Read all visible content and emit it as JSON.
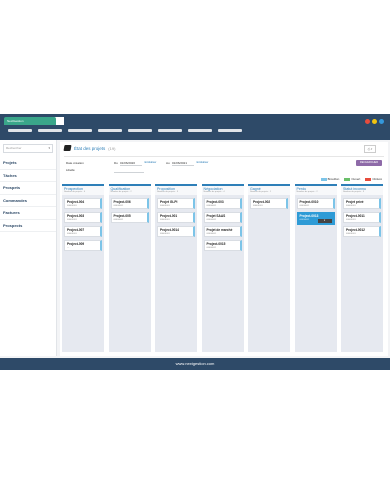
{
  "app": {
    "brand": "NextGestion"
  },
  "window_dots": [
    "#e74c3c",
    "#f1c40f",
    "#3498db"
  ],
  "sidebar": {
    "search_placeholder": "Rechercher",
    "items": [
      {
        "label": "Projets"
      },
      {
        "label": "Tâches"
      },
      {
        "label": "Prospets"
      },
      {
        "label": "Commandes"
      },
      {
        "label": "Factures"
      },
      {
        "label": "Prospects"
      }
    ]
  },
  "header": {
    "title": "État des projets",
    "count": "(19)",
    "print_label": "⎙ ▾"
  },
  "filters": {
    "creation_label": "Date création",
    "from_label": "Du",
    "from_value": "01/06/2020",
    "from_link": "réinitialiser",
    "to_label": "Au",
    "to_value": "01/06/2021",
    "to_link": "réinitialiser",
    "libelle_label": "Libellé",
    "search_button": "RECHERCHER"
  },
  "legend": [
    {
      "label": "Brouillon",
      "color": "#7cc4e8"
    },
    {
      "label": "Ouvert",
      "color": "#6abf69"
    },
    {
      "label": "Clôturé",
      "color": "#e74c3c"
    }
  ],
  "columns": [
    {
      "title": "Prospection",
      "sub": "Nombre de projets : 4",
      "cards": [
        {
          "title": "Project-004",
          "meta": "00000001"
        },
        {
          "title": "Project-003",
          "meta": "00000001"
        },
        {
          "title": "Project-007",
          "meta": "00000001"
        },
        {
          "title": "Project-009",
          "meta": "—"
        }
      ]
    },
    {
      "title": "Qualification",
      "sub": "Nombre de projets : 2",
      "cards": [
        {
          "title": "Project-006",
          "meta": "00000001"
        },
        {
          "title": "Project-005",
          "meta": "00000001"
        }
      ]
    },
    {
      "title": "Proposition",
      "sub": "Nombre de projets : 3",
      "cards": [
        {
          "title": "Projet GLPI",
          "meta": "00000001"
        },
        {
          "title": "Project-001",
          "meta": "00000001"
        },
        {
          "title": "Project-0014",
          "meta": "00000001"
        }
      ]
    },
    {
      "title": "Négociation",
      "sub": "Nombre de projets : 4",
      "cards": [
        {
          "title": "Project-003",
          "meta": "00000001"
        },
        {
          "title": "Projet SAAS",
          "meta": "00000001"
        },
        {
          "title": "Projet de marché",
          "meta": "00000001"
        },
        {
          "title": "Project-0015",
          "meta": "00000001"
        }
      ]
    },
    {
      "title": "Gagné",
      "sub": "Nombre de projets : 1",
      "cards": [
        {
          "title": "Project-002",
          "meta": "00000001"
        }
      ]
    },
    {
      "title": "Perdu",
      "sub": "Nombre de projets : 2",
      "cards": [
        {
          "title": "Project-0010",
          "meta": "00000001"
        },
        {
          "title": "Project-0013",
          "meta": "00000001",
          "active": true,
          "toggle": "▾"
        }
      ]
    },
    {
      "title": "Statut inconnu",
      "sub": "Nombre de projets : 3",
      "cards": [
        {
          "title": "Projet privé",
          "meta": "00000001"
        },
        {
          "title": "Project-0011",
          "meta": "00000001"
        },
        {
          "title": "Project-0012",
          "meta": "00000001"
        }
      ]
    }
  ],
  "footer": {
    "text": "www.nextgestion.com"
  }
}
